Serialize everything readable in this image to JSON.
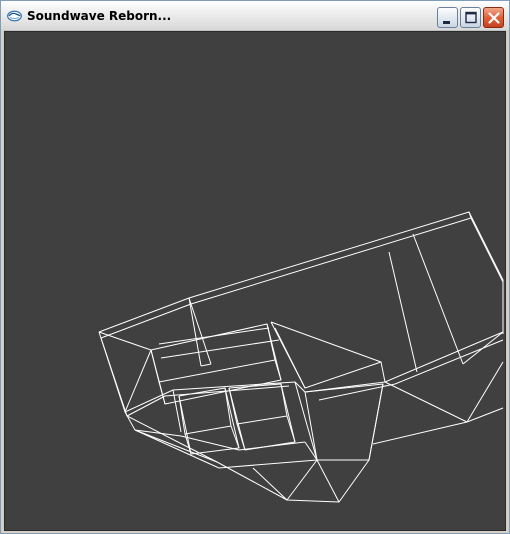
{
  "window": {
    "title": "Soundwave Reborn...",
    "icon": "app-window-icon",
    "controls": {
      "minimize": "minimize-icon",
      "maximize": "maximize-icon",
      "close": "close-icon"
    }
  },
  "viewport": {
    "background_color": "#404040",
    "wire_color": "#ffffff",
    "render_mode": "wireframe"
  }
}
